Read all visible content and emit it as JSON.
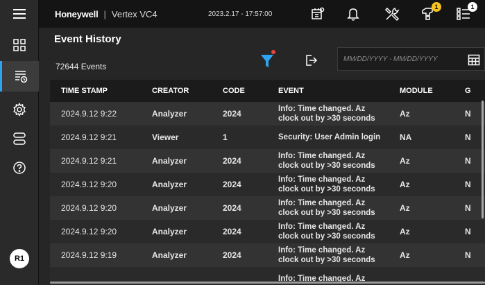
{
  "header": {
    "brand": "Honeywell",
    "separator": "|",
    "product": "Vertex VC4",
    "datetime": "2023.2.17 - 17:57:00",
    "alarm_badge": "1",
    "list_badge": "1"
  },
  "sidebar": {
    "user_initials": "R1",
    "active_item": "event-history"
  },
  "page": {
    "title": "Event History",
    "event_count": "72644 Events",
    "date_placeholder": "MM/DD/YYYY - MM/DD/YYYY"
  },
  "table": {
    "columns": [
      "TIME STAMP",
      "CREATOR",
      "CODE",
      "EVENT",
      "MODULE",
      "G"
    ],
    "rows": [
      {
        "ts": "2024.9.12 9:22",
        "creator": "Analyzer",
        "code": "2024",
        "event": "Info: Time changed. Az clock out by >30 seconds",
        "module": "Az",
        "g": "N"
      },
      {
        "ts": "2024.9.12 9:21",
        "creator": "Viewer",
        "code": "1",
        "event": "Security: User Admin login",
        "module": "NA",
        "g": "N"
      },
      {
        "ts": "2024.9.12 9:21",
        "creator": "Analyzer",
        "code": "2024",
        "event": "Info: Time changed. Az clock out by >30 seconds",
        "module": "Az",
        "g": "N"
      },
      {
        "ts": "2024.9.12 9:20",
        "creator": "Analyzer",
        "code": "2024",
        "event": "Info: Time changed. Az clock out by >30 seconds",
        "module": "Az",
        "g": "N"
      },
      {
        "ts": "2024.9.12 9:20",
        "creator": "Analyzer",
        "code": "2024",
        "event": "Info: Time changed. Az clock out by >30 seconds",
        "module": "Az",
        "g": "N"
      },
      {
        "ts": "2024.9.12 9:20",
        "creator": "Analyzer",
        "code": "2024",
        "event": "Info: Time changed. Az clock out by >30 seconds",
        "module": "Az",
        "g": "N"
      },
      {
        "ts": "2024.9.12 9:19",
        "creator": "Analyzer",
        "code": "2024",
        "event": "Info: Time changed. Az clock out by >30 seconds",
        "module": "Az",
        "g": "N"
      },
      {
        "ts": "",
        "creator": "",
        "code": "",
        "event": "Info: Time changed. Az",
        "module": "",
        "g": ""
      }
    ]
  },
  "colors": {
    "accent_blue": "#2ea3f2",
    "filter_red": "#e8473f",
    "badge_yellow": "#f6c11b"
  }
}
